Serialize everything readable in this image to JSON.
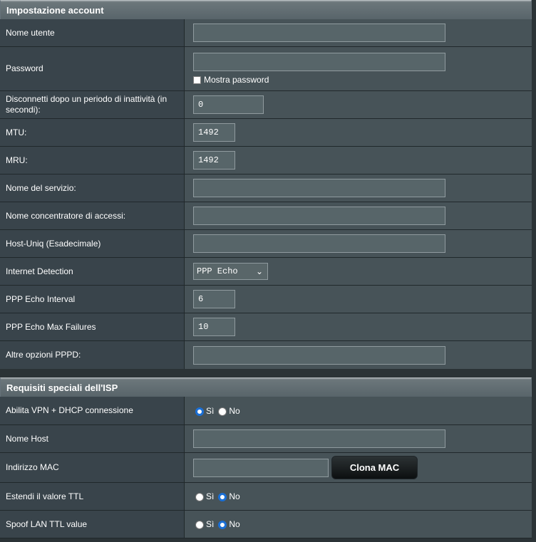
{
  "account": {
    "title": "Impostazione account",
    "username": {
      "label": "Nome utente",
      "value": ""
    },
    "password": {
      "label": "Password",
      "value": "",
      "show_label": "Mostra password",
      "show_checked": false
    },
    "idle": {
      "label": "Disconnetti dopo un periodo di inattività (in secondi):",
      "value": "0"
    },
    "mtu": {
      "label": "MTU:",
      "value": "1492"
    },
    "mru": {
      "label": "MRU:",
      "value": "1492"
    },
    "service": {
      "label": "Nome del servizio:",
      "value": ""
    },
    "concentrator": {
      "label": "Nome concentratore di accessi:",
      "value": ""
    },
    "hostuniq": {
      "label": "Host-Uniq (Esadecimale)",
      "value": ""
    },
    "detection": {
      "label": "Internet Detection",
      "selected": "PPP Echo"
    },
    "echo_interval": {
      "label": "PPP Echo Interval",
      "value": "6"
    },
    "echo_failures": {
      "label": "PPP Echo Max Failures",
      "value": "10"
    },
    "pppd": {
      "label": "Altre opzioni PPPD:",
      "value": ""
    }
  },
  "isp": {
    "title": "Requisiti speciali dell'ISP",
    "vpn_dhcp": {
      "label": "Abilita VPN + DHCP connessione",
      "yes": "Sì",
      "no": "No",
      "selected": "yes"
    },
    "hostname": {
      "label": "Nome Host",
      "value": ""
    },
    "mac": {
      "label": "Indirizzo MAC",
      "value": "",
      "button": "Clona MAC"
    },
    "ttl": {
      "label": "Estendi il valore TTL",
      "yes": "Sì",
      "no": "No",
      "selected": "no"
    },
    "spoof_ttl": {
      "label": "Spoof LAN TTL value",
      "yes": "Sì",
      "no": "No",
      "selected": "no"
    }
  },
  "colors": {
    "accent": "#1a6fd6",
    "panel": "#4b575c",
    "label_bg": "#39444b"
  }
}
